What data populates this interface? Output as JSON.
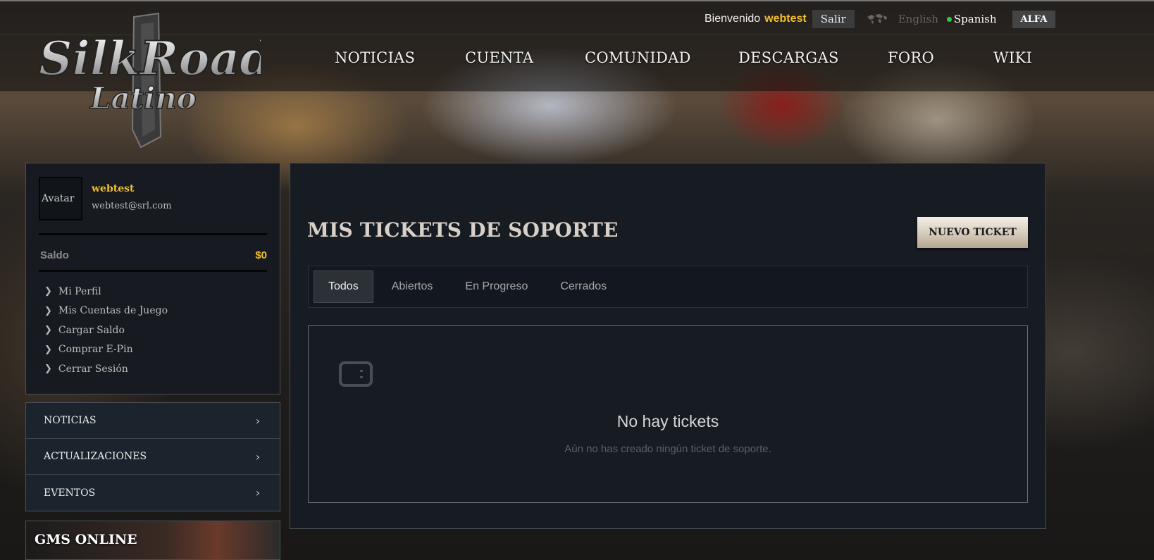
{
  "header": {
    "welcome_text": "Bienvenido",
    "username": "webtest",
    "logout_label": "Salir",
    "lang_english": "English",
    "lang_spanish": "Spanish",
    "server_label": "ALFA",
    "logo_text_line1": "SilkRoad",
    "logo_text_line2": "Latino"
  },
  "nav": {
    "items": [
      "NOTICIAS",
      "CUENTA",
      "COMUNIDAD",
      "DESCARGAS",
      "FORO",
      "WIKI"
    ]
  },
  "profile": {
    "avatar_alt": "Avatar",
    "name": "webtest",
    "email": "webtest@srl.com",
    "balance_label": "Saldo",
    "balance_value": "$0",
    "menu": [
      "Mi Perfil",
      "Mis Cuentas de Juego",
      "Cargar Saldo",
      "Comprar E-Pin",
      "Cerrar Sesión"
    ]
  },
  "sidebar_sections": {
    "items": [
      "NOTICIAS",
      "ACTUALIZACIONES",
      "EVENTOS"
    ],
    "gms_title": "GMS ONLINE"
  },
  "main": {
    "title": "MIS TICKETS DE SOPORTE",
    "new_ticket_label": "NUEVO TICKET",
    "tabs": [
      "Todos",
      "Abiertos",
      "En Progreso",
      "Cerrados"
    ],
    "active_tab": "Todos",
    "empty_title": "No hay tickets",
    "empty_subtitle": "Aún no has creado ningún ticket de soporte."
  },
  "colors": {
    "accent_gold": "#f0c02a",
    "online_green": "#2ecc40",
    "panel_bg": "#171b22"
  },
  "icons": [
    "world-map-icon",
    "chevron-right-icon",
    "ticket-icon"
  ]
}
